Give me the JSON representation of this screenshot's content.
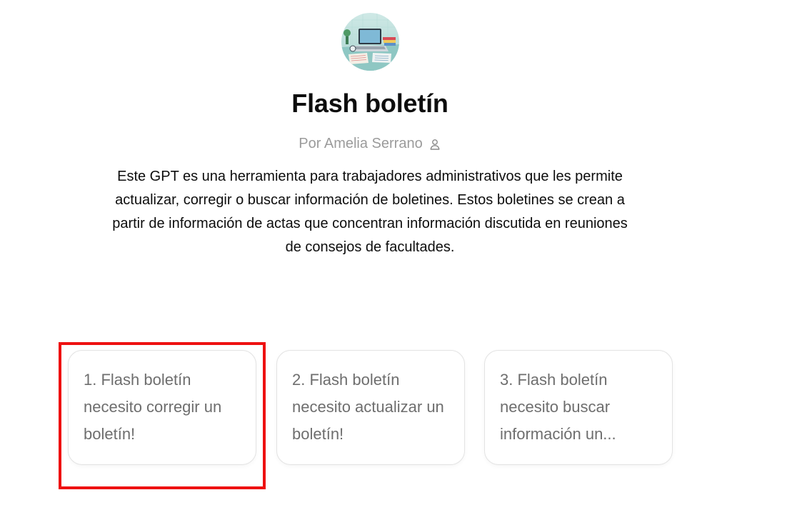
{
  "gpt": {
    "name": "Flash boletín",
    "author": "Por Amelia Serrano",
    "author_icon": "user-icon",
    "avatar_icon": "desk-laptop-illustration",
    "description": "Este GPT es una herramienta para trabajadores administrativos que les permite actualizar, corregir o buscar información de boletines. Estos boletines se crean a partir de información de actas que concentran información discutida en reuniones de consejos de facultades."
  },
  "conversation_starters": [
    {
      "label": "1. Flash boletín necesito corregir un boletín!"
    },
    {
      "label": "2. Flash boletín necesito actualizar un boletín!"
    },
    {
      "label": "3. Flash boletín necesito buscar información un..."
    }
  ],
  "colors": {
    "title": "#0d0d0d",
    "author": "#9b9b9b",
    "starter_text": "#6e6e6e",
    "starter_border": "#e3e3e3",
    "highlight": "#ee1111"
  }
}
